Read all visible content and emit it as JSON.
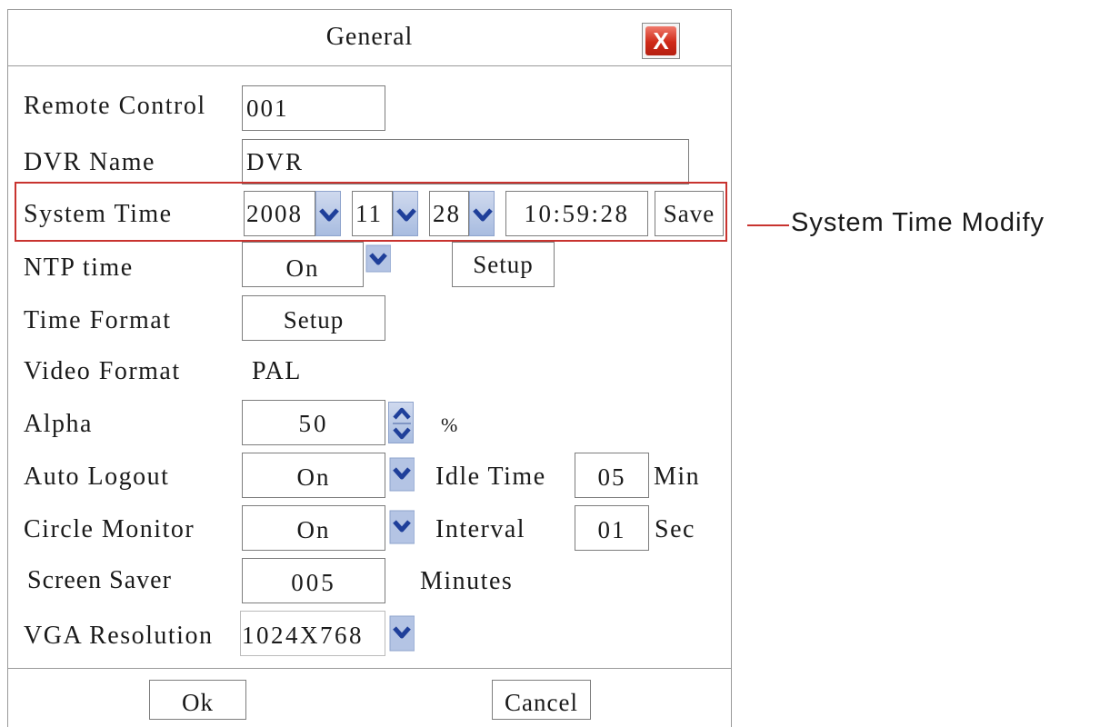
{
  "dialog": {
    "title": "General",
    "close_label": "X"
  },
  "fields": {
    "remote_control": {
      "label": "Remote Control",
      "value": "001"
    },
    "dvr_name": {
      "label": "DVR Name",
      "value": "DVR"
    },
    "system_time": {
      "label": "System Time",
      "year": "2008",
      "month": "11",
      "day": "28",
      "time": "10:59:28",
      "save_label": "Save"
    },
    "ntp_time": {
      "label": "NTP time",
      "value": "On",
      "setup_label": "Setup"
    },
    "time_format": {
      "label": "Time Format",
      "setup_label": "Setup"
    },
    "video_format": {
      "label": "Video Format",
      "value": "PAL"
    },
    "alpha": {
      "label": "Alpha",
      "value": "50",
      "unit": "%"
    },
    "auto_logout": {
      "label": "Auto Logout",
      "value": "On",
      "idle_label": "Idle Time",
      "idle_value": "05",
      "idle_unit": "Min"
    },
    "circle_monitor": {
      "label": "Circle Monitor",
      "value": "On",
      "interval_label": "Interval",
      "interval_value": "01",
      "interval_unit": "Sec"
    },
    "screen_saver": {
      "label": "Screen Saver",
      "value": "005",
      "unit": "Minutes"
    },
    "vga_resolution": {
      "label": "VGA Resolution",
      "value": "1024X768"
    }
  },
  "footer": {
    "ok_label": "Ok",
    "cancel_label": "Cancel"
  },
  "annotation": {
    "text": "System Time Modify",
    "color": "#c8332f"
  },
  "icons": {
    "dropdown": "chevron-down-icon",
    "spinner": "up-down-arrows-icon",
    "close": "close-icon"
  }
}
